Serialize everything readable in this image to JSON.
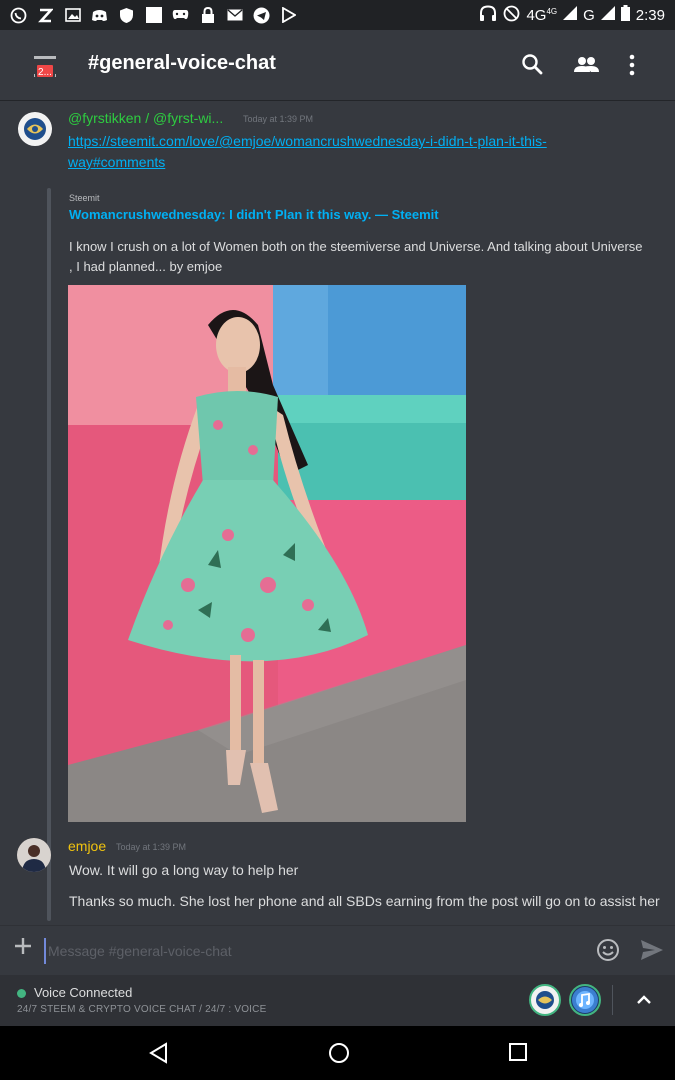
{
  "status_bar": {
    "left_icons": [
      "whatsapp-icon",
      "z-icon",
      "image-icon",
      "discord-icon",
      "shield-icon",
      "square-icon",
      "game-controller-icon",
      "lock-icon",
      "mail-icon",
      "telegram-icon",
      "play-store-icon"
    ],
    "network_label": "4G",
    "network_small": "4G",
    "g_label": "G",
    "time": "2:39"
  },
  "header": {
    "badge": "2...",
    "channel_name": "#general-voice-chat"
  },
  "messages": [
    {
      "author": "@fyrstikken / @fyrst-wi...",
      "author_color": "#2ecc40",
      "timestamp": "Today at 1:39 PM",
      "link": "https://steemit.com/love/@emjoe/womancrushwednesday-i-didn-t-plan-it-this-way#comments",
      "link_line1": "https://steemit.com/love/@emjoe/womancrushwednesday-i-didn-t-plan-it-this-",
      "link_line2": "way#comments",
      "embed": {
        "provider": "Steemit",
        "title": "Womancrushwednesday: I didn't Plan it this way. — Steemit",
        "description": "I know I crush on a lot of Women both on the steemiverse and Universe. And talking about Universe  , I had planned... by emjoe"
      }
    },
    {
      "author": "emjoe",
      "author_color": "#f1c40f",
      "timestamp": "Today at 1:39 PM",
      "lines": [
        "Wow. It will go a long way to help her",
        "Thanks so much. She lost her phone and all SBDs earning from the post will go on to assist her"
      ]
    }
  ],
  "composer": {
    "placeholder": "Message #general-voice-chat"
  },
  "voice": {
    "status": "Voice Connected",
    "channel": "24/7 STEEM & CRYPTO VOICE CHAT / 24/7 : VOICE"
  },
  "colors": {
    "accent": "#7289da",
    "link": "#00b0f4",
    "online": "#43b581",
    "background": "#36393f"
  }
}
